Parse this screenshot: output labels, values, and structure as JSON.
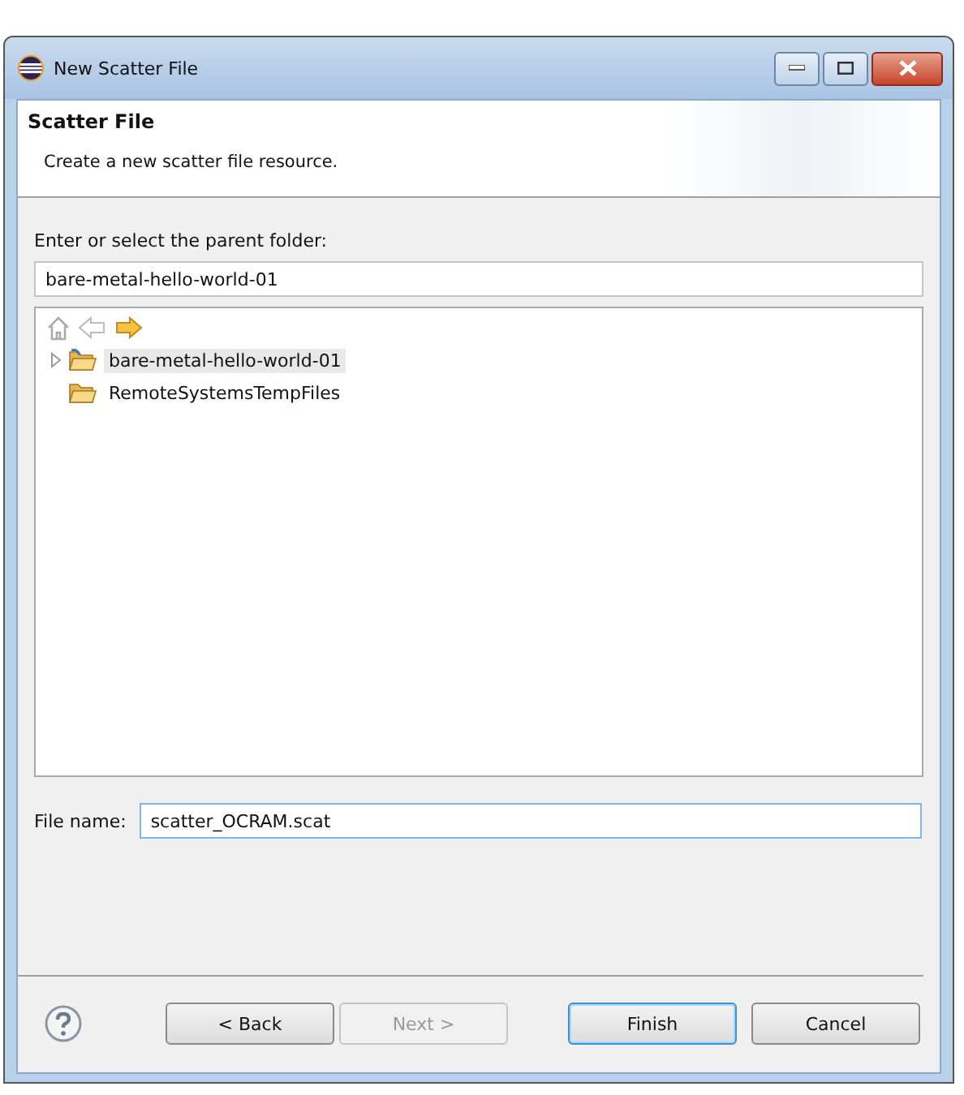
{
  "window": {
    "title": "New Scatter File"
  },
  "header": {
    "title": "Scatter File",
    "description": "Create a new scatter file resource."
  },
  "folder": {
    "label": "Enter or select the parent folder:",
    "value": "bare-metal-hello-world-01"
  },
  "tree": {
    "items": [
      {
        "label": "bare-metal-hello-world-01",
        "selected": true,
        "expandable": true
      },
      {
        "label": "RemoteSystemsTempFiles",
        "selected": false,
        "expandable": false
      }
    ]
  },
  "file_name": {
    "label": "File name:",
    "value": "scatter_OCRAM.scat"
  },
  "buttons": [
    {
      "label": "< Back",
      "disabled": false,
      "default": false
    },
    {
      "label": "Next >",
      "disabled": true,
      "default": false
    },
    {
      "label": "Finish",
      "disabled": false,
      "default": true
    },
    {
      "label": "Cancel",
      "disabled": false,
      "default": false
    }
  ]
}
